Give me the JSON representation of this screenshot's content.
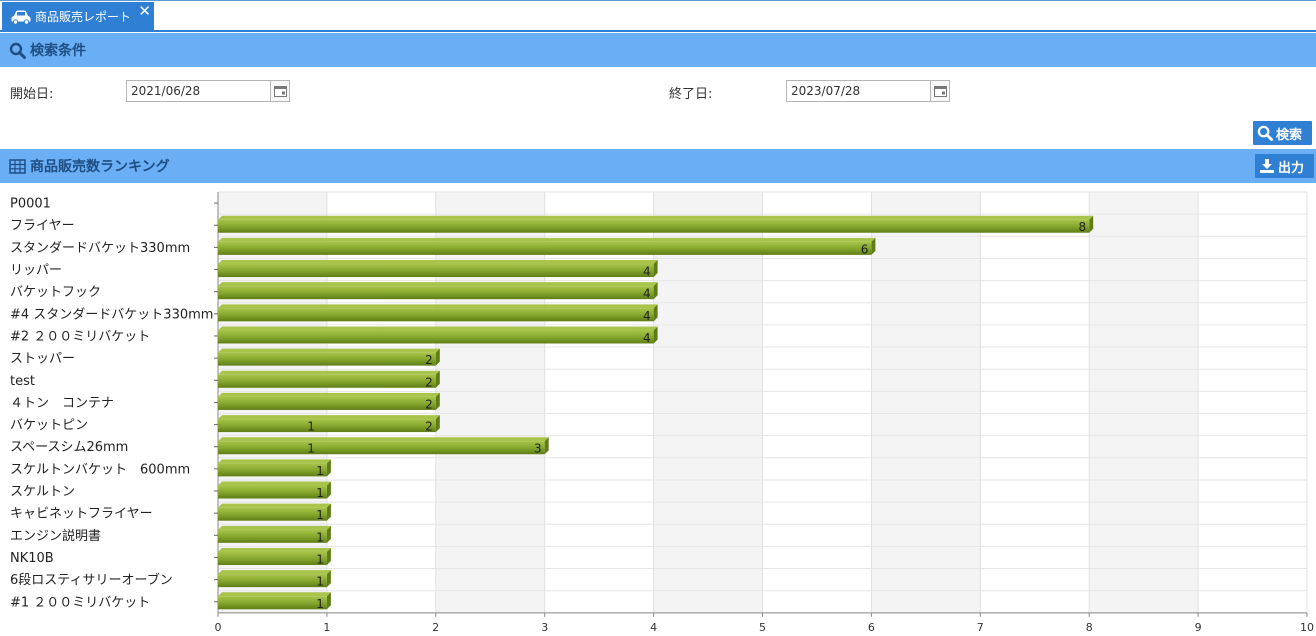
{
  "tab": {
    "label": "商品販売レポート",
    "close": "✕"
  },
  "search": {
    "header": "検索条件",
    "start_label": "開始日:",
    "start_value": "2021/06/28",
    "end_label": "終了日:",
    "end_value": "2023/07/28",
    "search_button": "検索"
  },
  "ranking": {
    "header": "商品販売数ランキング",
    "export_button": "出力"
  },
  "colors": {
    "accent": "#2f7fd4",
    "header_bg": "#6aaef5",
    "header_text": "#1f4e83",
    "bar_top": "#a8c44a",
    "bar_mid": "#86a82e",
    "bar_bottom": "#5f7d16",
    "band": "#f4f4f4"
  },
  "chart_data": {
    "type": "bar",
    "orientation": "horizontal",
    "categories": [
      "P0001",
      "フライヤー",
      "スタンダードバケット330mm",
      "リッパー",
      "バケットフック",
      "#4 スタンダードバケット330mm",
      "#2 ２００ミリバケット",
      "ストッパー",
      "test",
      "４トン　コンテナ",
      "バケットピン",
      "スペースシム26mm",
      "スケルトンバケット　600mm",
      "スケルトン",
      "キャビネットフライヤー",
      "エンジン説明書",
      "NK10B",
      "6段ロスティサリーオーブン",
      "#1 ２００ミリバケット"
    ],
    "values": [
      0,
      8,
      6,
      4,
      4,
      4,
      4,
      2,
      2,
      2,
      2,
      3,
      1,
      1,
      1,
      1,
      1,
      1,
      1
    ],
    "inner_labels": [
      null,
      null,
      null,
      null,
      null,
      null,
      null,
      null,
      null,
      null,
      1,
      1,
      null,
      null,
      null,
      null,
      null,
      null,
      null
    ],
    "xlim": [
      0,
      10
    ],
    "xticks": [
      "0",
      "1",
      "2",
      "3",
      "4",
      "5",
      "6",
      "7",
      "8",
      "9",
      "10"
    ],
    "grid": true
  }
}
